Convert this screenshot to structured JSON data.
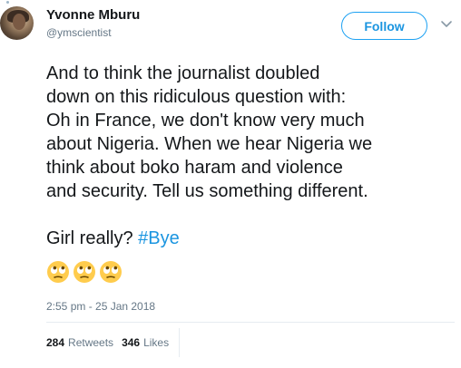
{
  "author": {
    "name": "Yvonne Mburu",
    "handle": "@ymscientist"
  },
  "follow_button": {
    "label": "Follow"
  },
  "tweet": {
    "lines": [
      "And to think the journalist doubled",
      "down on this ridiculous question with:",
      "Oh in France, we don't know very much",
      "about Nigeria. When we hear Nigeria we",
      "think about boko haram and violence",
      "and security. Tell us something different."
    ],
    "closing_text": "Girl really? ",
    "hashtag": "#Bye",
    "emojis": [
      "face-with-rolling-eyes",
      "face-with-rolling-eyes",
      "face-with-rolling-eyes"
    ]
  },
  "timestamp": "2:55 pm - 25 Jan 2018",
  "stats": {
    "retweets_count": "284",
    "retweets_label": "Retweets",
    "likes_count": "346",
    "likes_label": "Likes"
  },
  "colors": {
    "accent": "#1b95e0",
    "text": "#14171a",
    "muted": "#657786",
    "divider": "#e6ecf0"
  }
}
